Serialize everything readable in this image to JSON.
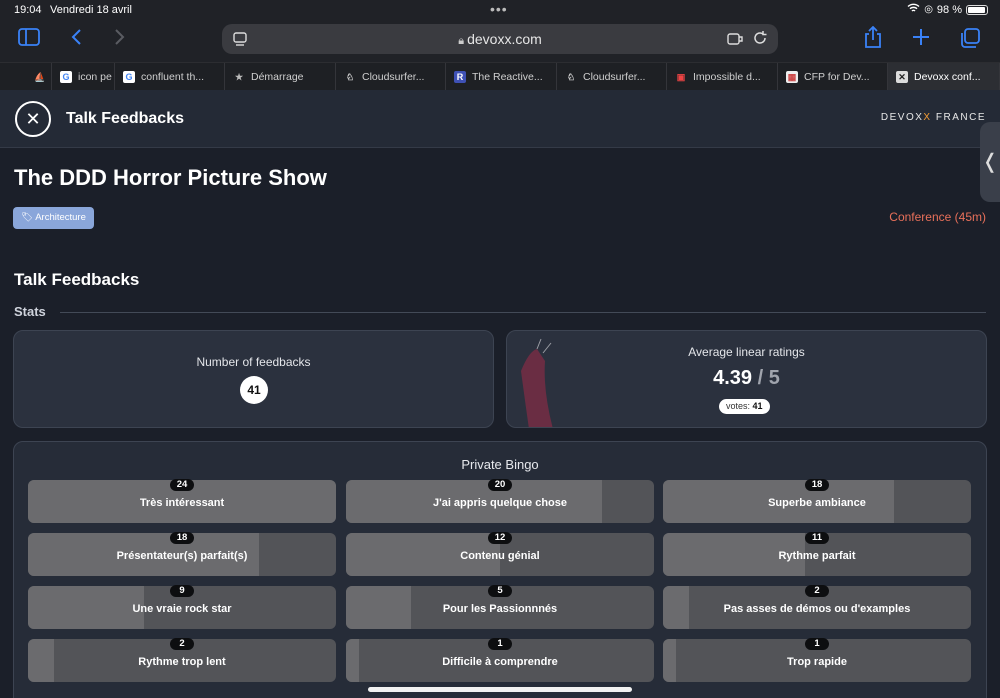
{
  "status_bar": {
    "time": "19:04",
    "date": "Vendredi 18 avril",
    "battery": "98 %"
  },
  "browser": {
    "url": "devoxx.com",
    "tabs": [
      {
        "label": "",
        "icon": "ship-icon"
      },
      {
        "label": "icon pe",
        "icon": "google-icon"
      },
      {
        "label": "confluent th...",
        "icon": "google-icon"
      },
      {
        "label": "Démarrage",
        "icon": "star-icon"
      },
      {
        "label": "Cloudsurfer...",
        "icon": "cloudsurfer-icon"
      },
      {
        "label": "The Reactive...",
        "icon": "reactive-icon"
      },
      {
        "label": "Cloudsurfer...",
        "icon": "cloudsurfer-icon"
      },
      {
        "label": "Impossible d...",
        "icon": "warning-icon"
      },
      {
        "label": "CFP for Dev...",
        "icon": "cfp-icon"
      },
      {
        "label": "Devoxx conf...",
        "icon": "devoxx-icon"
      }
    ]
  },
  "header": {
    "title": "Talk Feedbacks",
    "logo_left": "DEVOX",
    "logo_x": "X",
    "logo_right": " FRANCE"
  },
  "talk": {
    "title": "The DDD Horror Picture Show",
    "tag": "Architecture",
    "format": "Conference (45m)"
  },
  "section": {
    "title": "Talk Feedbacks",
    "stats_label": "Stats"
  },
  "stats": {
    "feedbacks_label": "Number of feedbacks",
    "feedbacks_count": "41",
    "ratings_label": "Average linear ratings",
    "average": "4.39",
    "max": " / 5",
    "votes_label": "votes:",
    "votes": "41"
  },
  "bingo": {
    "title": "Private Bingo",
    "items": [
      {
        "label": "Très intéressant",
        "count": "24",
        "fill": 1.0
      },
      {
        "label": "J'ai appris quelque chose",
        "count": "20",
        "fill": 0.83
      },
      {
        "label": "Superbe ambiance",
        "count": "18",
        "fill": 0.75
      },
      {
        "label": "Présentateur(s) parfait(s)",
        "count": "18",
        "fill": 0.75
      },
      {
        "label": "Contenu génial",
        "count": "12",
        "fill": 0.5
      },
      {
        "label": "Rythme parfait",
        "count": "11",
        "fill": 0.46
      },
      {
        "label": "Une vraie rock star",
        "count": "9",
        "fill": 0.375
      },
      {
        "label": "Pour les Passionnnés",
        "count": "5",
        "fill": 0.21
      },
      {
        "label": "Pas asses de démos ou d'examples",
        "count": "2",
        "fill": 0.083
      },
      {
        "label": "Rythme trop lent",
        "count": "2",
        "fill": 0.083
      },
      {
        "label": "Difficile à comprendre",
        "count": "1",
        "fill": 0.042
      },
      {
        "label": "Trop rapide",
        "count": "1",
        "fill": 0.042
      }
    ]
  }
}
